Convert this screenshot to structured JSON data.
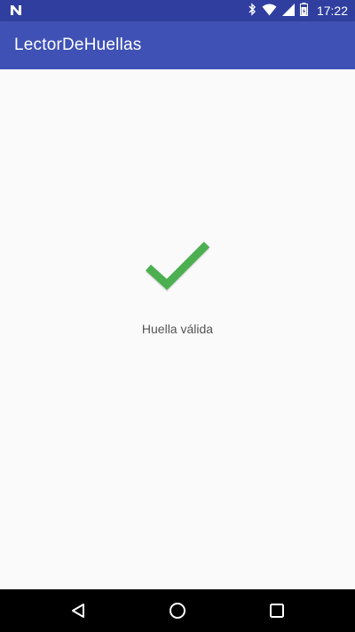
{
  "status_bar": {
    "time": "17:22",
    "icons": [
      "notification-n-icon",
      "bluetooth-icon",
      "wifi-icon",
      "signal-icon",
      "battery-icon"
    ]
  },
  "app_bar": {
    "title": "LectorDeHuellas",
    "color": "#3F51B5",
    "status_color": "#303F9F"
  },
  "main": {
    "icon": "check-icon",
    "icon_color": "#4CAF50",
    "message": "Huella válida"
  },
  "nav_bar": {
    "buttons": [
      "back-icon",
      "home-icon",
      "recents-icon"
    ]
  }
}
